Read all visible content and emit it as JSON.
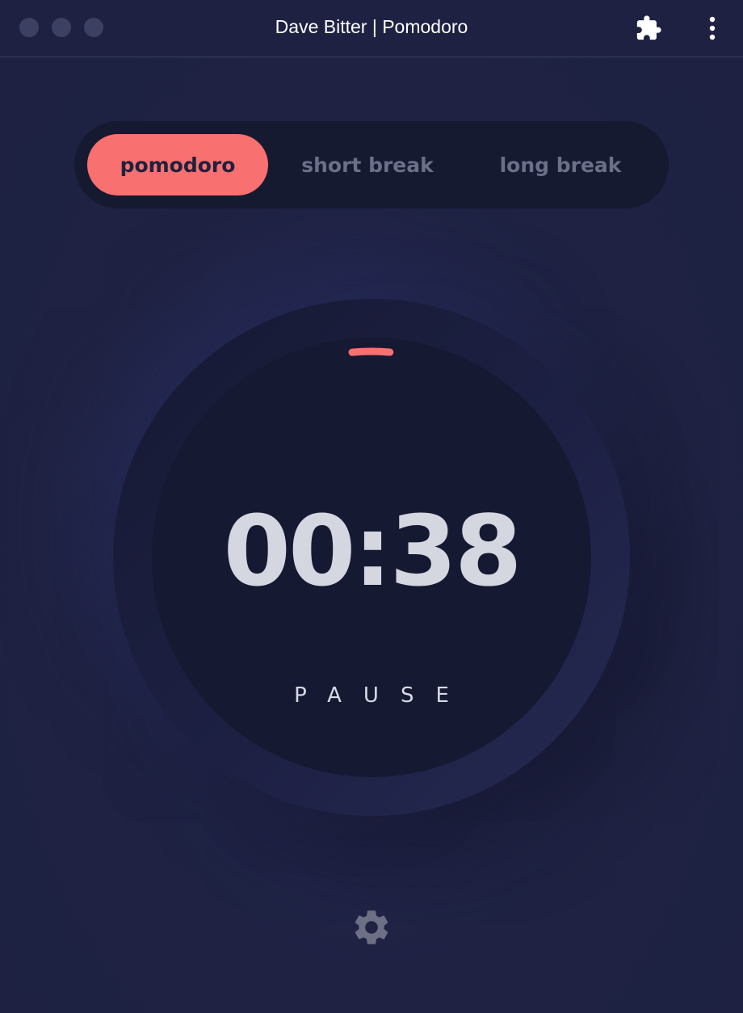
{
  "window": {
    "title": "Dave Bitter | Pomodoro"
  },
  "modes": {
    "tabs": [
      {
        "label": "pomodoro",
        "active": true
      },
      {
        "label": "short break",
        "active": false
      },
      {
        "label": "long break",
        "active": false
      }
    ]
  },
  "timer": {
    "time": "00:38",
    "action_label": "PAUSE",
    "progress_fraction": 0.03
  },
  "colors": {
    "accent": "#f87070",
    "background": "#1e2141",
    "dark": "#161932"
  },
  "icons": {
    "toolbar": [
      "puzzle-icon",
      "more-vertical-icon"
    ],
    "footer": [
      "gear-icon"
    ]
  }
}
